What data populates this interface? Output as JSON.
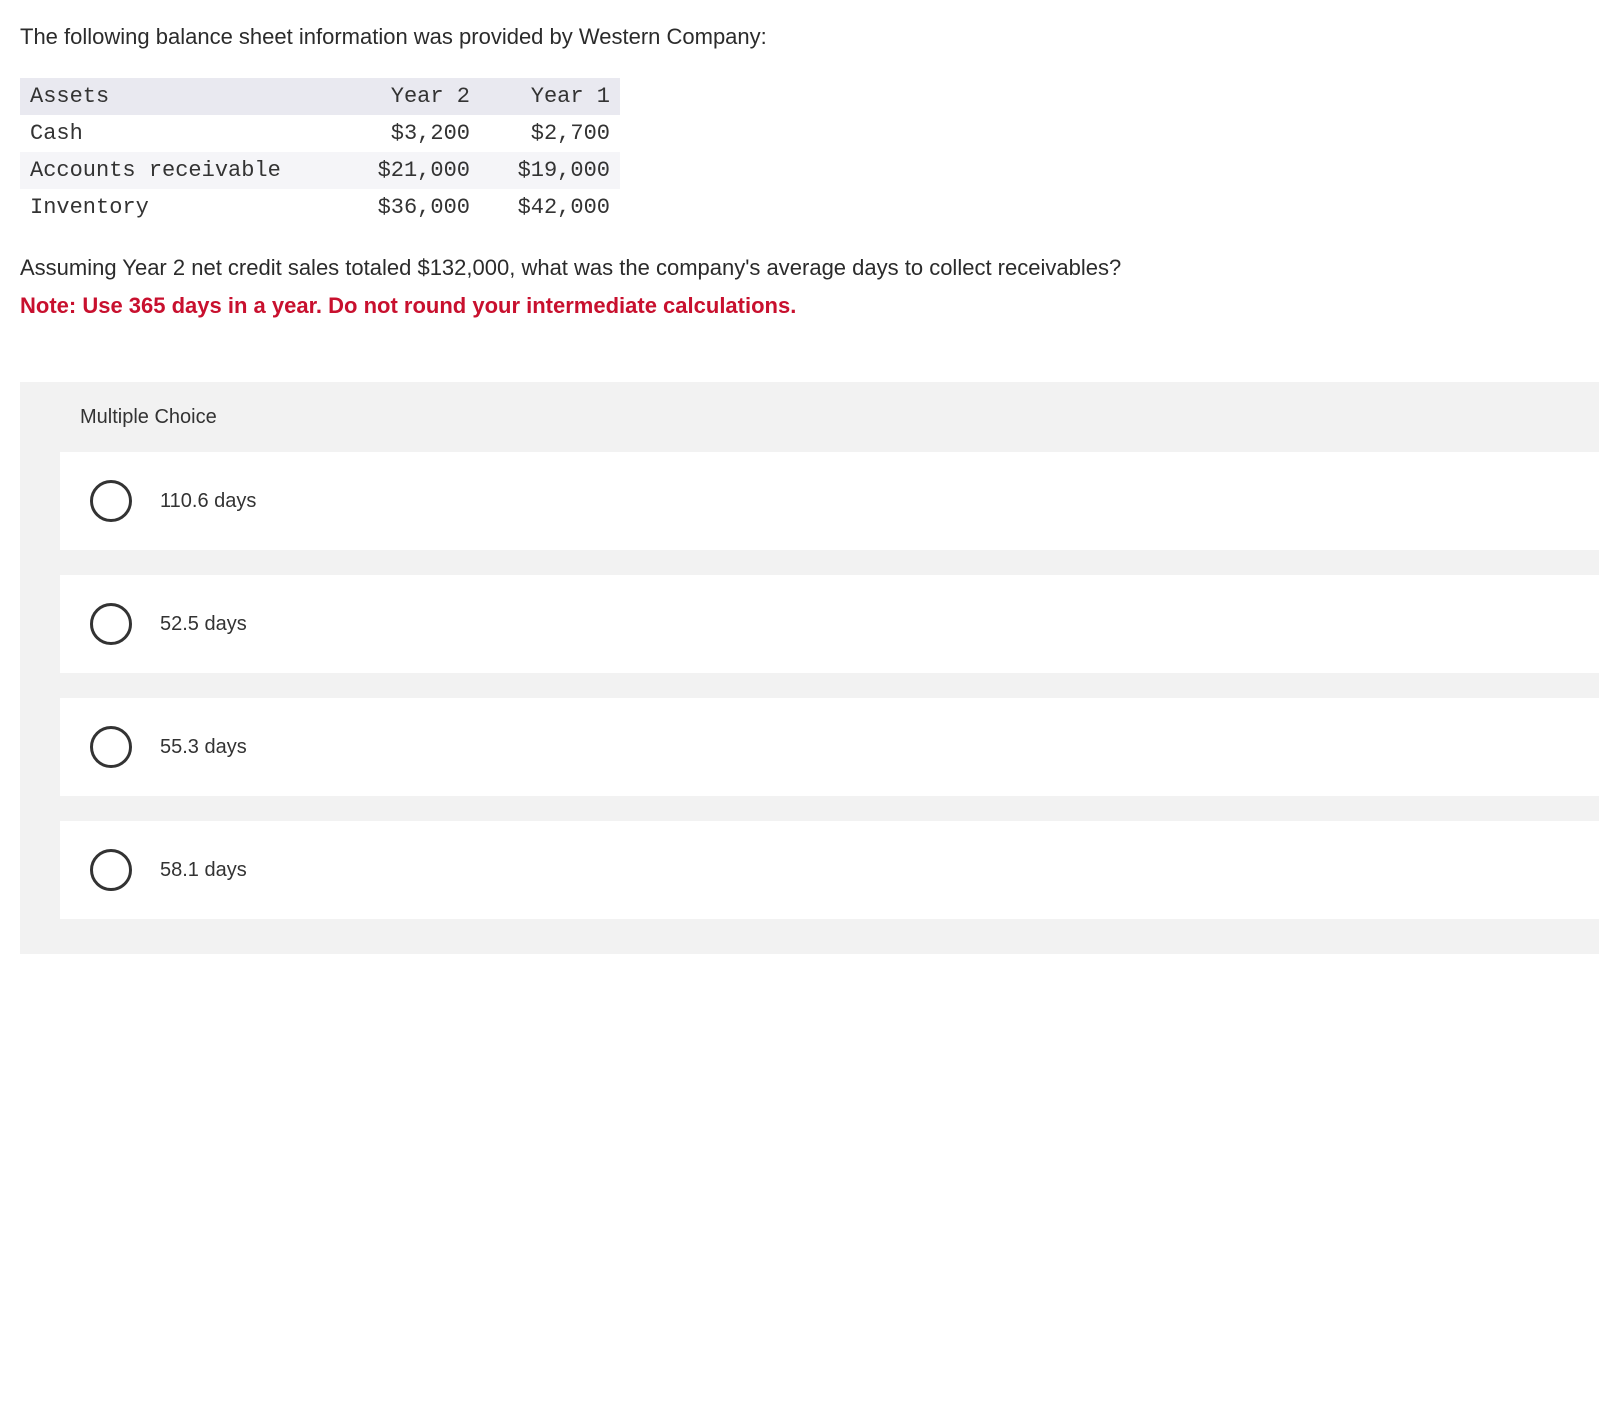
{
  "intro": "The following balance sheet information was provided by Western Company:",
  "table": {
    "headers": {
      "c0": "Assets",
      "c1": "Year 2",
      "c2": "Year 1"
    },
    "rows": [
      {
        "label": "Cash",
        "y2": "$3,200",
        "y1": "$2,700"
      },
      {
        "label": "Accounts receivable",
        "y2": "$21,000",
        "y1": "$19,000"
      },
      {
        "label": "Inventory",
        "y2": "$36,000",
        "y1": "$42,000"
      }
    ]
  },
  "question": "Assuming Year 2 net credit sales totaled $132,000, what was the company's average days to collect receivables?",
  "note": "Note: Use 365 days in a year. Do not round your intermediate calculations.",
  "mc_label": "Multiple Choice",
  "options": [
    {
      "label": "110.6 days"
    },
    {
      "label": "52.5 days"
    },
    {
      "label": "55.3 days"
    },
    {
      "label": "58.1 days"
    }
  ]
}
